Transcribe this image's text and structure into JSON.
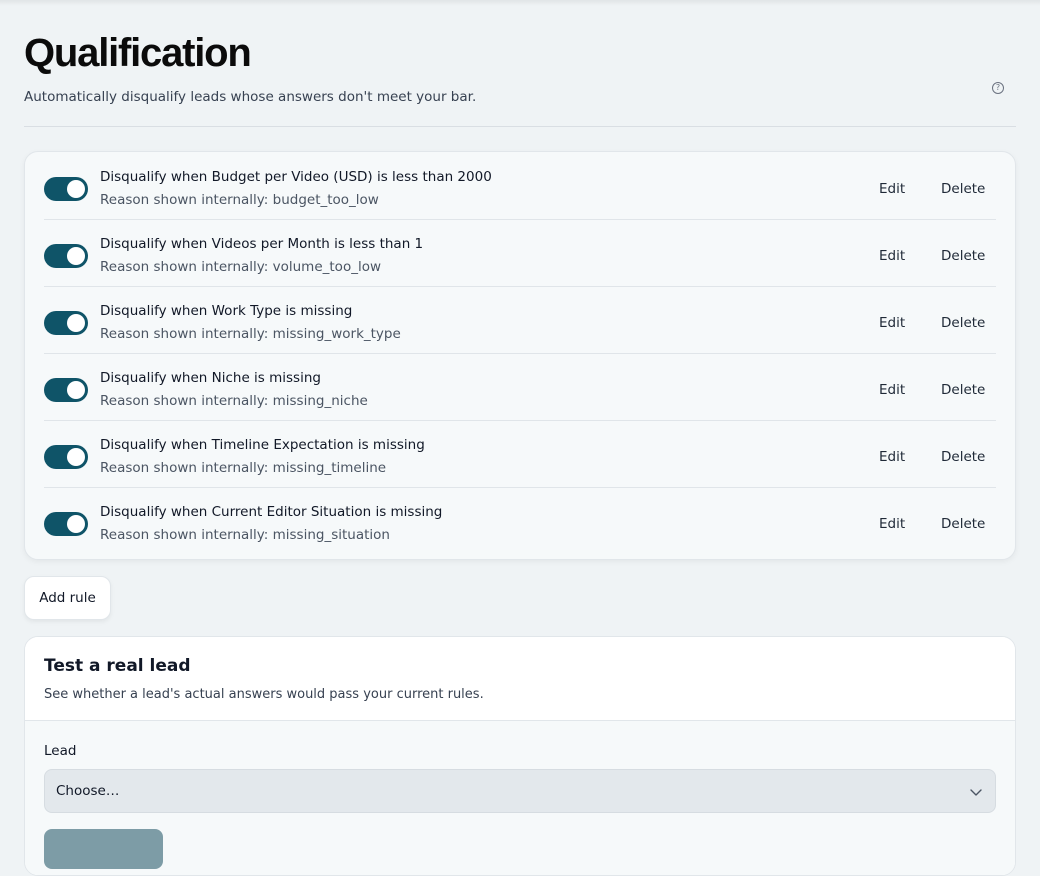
{
  "header": {
    "title": "Qualification",
    "subtitle": "Automatically disqualify leads whose answers don't meet your bar.",
    "help_icon": "?"
  },
  "rules": [
    {
      "title": "Disqualify when Budget per Video (USD) is less than 2000",
      "reason": "Reason shown internally: budget_too_low",
      "enabled": true,
      "edit_label": "Edit",
      "delete_label": "Delete"
    },
    {
      "title": "Disqualify when Videos per Month is less than 1",
      "reason": "Reason shown internally: volume_too_low",
      "enabled": true,
      "edit_label": "Edit",
      "delete_label": "Delete"
    },
    {
      "title": "Disqualify when Work Type is missing",
      "reason": "Reason shown internally: missing_work_type",
      "enabled": true,
      "edit_label": "Edit",
      "delete_label": "Delete"
    },
    {
      "title": "Disqualify when Niche is missing",
      "reason": "Reason shown internally: missing_niche",
      "enabled": true,
      "edit_label": "Edit",
      "delete_label": "Delete"
    },
    {
      "title": "Disqualify when Timeline Expectation is missing",
      "reason": "Reason shown internally: missing_timeline",
      "enabled": true,
      "edit_label": "Edit",
      "delete_label": "Delete"
    },
    {
      "title": "Disqualify when Current Editor Situation is missing",
      "reason": "Reason shown internally: missing_situation",
      "enabled": true,
      "edit_label": "Edit",
      "delete_label": "Delete"
    }
  ],
  "add_rule_label": "Add rule",
  "test": {
    "title": "Test a real lead",
    "subtitle": "See whether a lead's actual answers would pass your current rules.",
    "lead_label": "Lead",
    "lead_select_value": "Choose…"
  },
  "colors": {
    "toggle_on": "#0f5468",
    "background": "#eff3f5",
    "run_button": "#7d9ca6"
  }
}
